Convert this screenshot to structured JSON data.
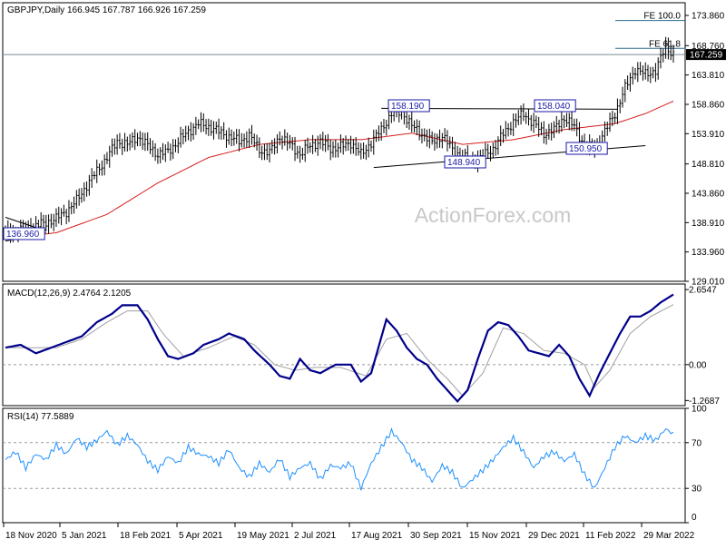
{
  "chart_data": [
    {
      "type": "candlestick",
      "symbol": "GBPJPY",
      "timeframe": "Daily",
      "header": "GBPJPY,Daily  166.945 167.787 166.926 167.259",
      "ohlc_last": [
        166.945,
        167.787,
        166.926,
        167.259
      ],
      "last_price_label": "167.259",
      "watermark": "ActionForex.com",
      "ylim": [
        129.01,
        176.0
      ],
      "y_ticks": [
        "173.860",
        "168.760",
        "163.810",
        "158.860",
        "153.910",
        "148.810",
        "143.860",
        "138.910",
        "133.960",
        "129.010"
      ],
      "x_ticks": [
        "18 Nov 2020",
        "5 Jan 2021",
        "18 Feb 2021",
        "5 Apr 2021",
        "19 May 2021",
        "2 Jul 2021",
        "17 Aug 2021",
        "30 Sep 2021",
        "15 Nov 2021",
        "29 Dec 2021",
        "11 Feb 2022",
        "29 Mar 2022"
      ],
      "price_path": [
        [
          0,
          137.5
        ],
        [
          4,
          137.2
        ],
        [
          8,
          137.9
        ],
        [
          12,
          138.4
        ],
        [
          16,
          138.9
        ],
        [
          20,
          139.6
        ],
        [
          24,
          140.8
        ],
        [
          28,
          142.6
        ],
        [
          32,
          145.2
        ],
        [
          36,
          147.6
        ],
        [
          40,
          149.9
        ],
        [
          44,
          152.6
        ],
        [
          48,
          152.1
        ],
        [
          52,
          153.4
        ],
        [
          56,
          151.9
        ],
        [
          60,
          150.4
        ],
        [
          64,
          150.9
        ],
        [
          68,
          152.6
        ],
        [
          72,
          154.3
        ],
        [
          76,
          155.6
        ],
        [
          80,
          155.1
        ],
        [
          84,
          154.3
        ],
        [
          88,
          153.4
        ],
        [
          92,
          152.6
        ],
        [
          96,
          153.6
        ],
        [
          100,
          151.2
        ],
        [
          104,
          150.7
        ],
        [
          108,
          153.4
        ],
        [
          112,
          152.1
        ],
        [
          116,
          150.4
        ],
        [
          120,
          151.9
        ],
        [
          124,
          152.6
        ],
        [
          128,
          151.4
        ],
        [
          132,
          151.7
        ],
        [
          136,
          152.4
        ],
        [
          140,
          150.4
        ],
        [
          144,
          152.4
        ],
        [
          148,
          154.6
        ],
        [
          152,
          157.3
        ],
        [
          156,
          157.6
        ],
        [
          160,
          155.2
        ],
        [
          164,
          153.9
        ],
        [
          168,
          152.4
        ],
        [
          172,
          153.6
        ],
        [
          176,
          151.2
        ],
        [
          180,
          149.9
        ],
        [
          184,
          149.4
        ],
        [
          188,
          150.1
        ],
        [
          192,
          151.4
        ],
        [
          196,
          153.9
        ],
        [
          200,
          155.9
        ],
        [
          204,
          157.3
        ],
        [
          208,
          155.6
        ],
        [
          212,
          153.9
        ],
        [
          216,
          154.6
        ],
        [
          220,
          156.6
        ],
        [
          224,
          155.1
        ],
        [
          228,
          151.9
        ],
        [
          232,
          151.4
        ],
        [
          236,
          154.3
        ],
        [
          240,
          157.3
        ],
        [
          244,
          161.6
        ],
        [
          248,
          164.8
        ],
        [
          252,
          163.9
        ],
        [
          256,
          164.6
        ],
        [
          260,
          168.6
        ],
        [
          263,
          167.3
        ]
      ],
      "sma_path": [
        [
          0,
          136.2
        ],
        [
          20,
          137.2
        ],
        [
          40,
          140.3
        ],
        [
          60,
          145.6
        ],
        [
          80,
          149.9
        ],
        [
          100,
          152.1
        ],
        [
          120,
          152.9
        ],
        [
          140,
          152.9
        ],
        [
          160,
          154.0
        ],
        [
          180,
          152.1
        ],
        [
          200,
          152.9
        ],
        [
          220,
          154.6
        ],
        [
          240,
          155.6
        ],
        [
          252,
          157.3
        ],
        [
          263,
          159.4
        ]
      ],
      "annotations": [
        {
          "label": "158.190",
          "value": 158.19,
          "target": "price"
        },
        {
          "label": "158.040",
          "value": 158.04,
          "target": "price"
        },
        {
          "label": "148.940",
          "value": 148.94,
          "target": "price"
        },
        {
          "label": "150.950",
          "value": 150.95,
          "target": "price"
        },
        {
          "label": "136.960",
          "value": 136.96,
          "target": "price"
        },
        {
          "label": "FE 100.0",
          "value": 173.0,
          "target": "price"
        },
        {
          "label": "FE 61.8",
          "value": 168.3,
          "target": "price"
        }
      ],
      "trendlines": [
        {
          "from": [
            148,
            158.19
          ],
          "to": [
            241,
            158.04
          ]
        },
        {
          "from": [
            145,
            148.2
          ],
          "to": [
            252,
            151.9
          ]
        }
      ]
    },
    {
      "type": "line",
      "title": "MACD(12,26,9) 2.4764 2.1205",
      "series": [
        {
          "name": "MACD",
          "color": "#00008b",
          "values": [
            [
              0,
              0.6
            ],
            [
              6,
              0.7
            ],
            [
              12,
              0.4
            ],
            [
              18,
              0.6
            ],
            [
              24,
              0.8
            ],
            [
              30,
              1.0
            ],
            [
              36,
              1.5
            ],
            [
              42,
              1.8
            ],
            [
              46,
              2.1
            ],
            [
              52,
              2.1
            ],
            [
              56,
              1.6
            ],
            [
              60,
              0.9
            ],
            [
              64,
              0.3
            ],
            [
              68,
              0.2
            ],
            [
              74,
              0.4
            ],
            [
              78,
              0.7
            ],
            [
              84,
              0.9
            ],
            [
              88,
              1.1
            ],
            [
              94,
              0.9
            ],
            [
              98,
              0.5
            ],
            [
              104,
              0.0
            ],
            [
              108,
              -0.4
            ],
            [
              112,
              -0.5
            ],
            [
              116,
              0.2
            ],
            [
              120,
              -0.2
            ],
            [
              124,
              -0.3
            ],
            [
              130,
              0.0
            ],
            [
              136,
              0.0
            ],
            [
              140,
              -0.6
            ],
            [
              144,
              -0.3
            ],
            [
              150,
              1.6
            ],
            [
              154,
              1.2
            ],
            [
              158,
              0.6
            ],
            [
              162,
              0.2
            ],
            [
              166,
              0.0
            ],
            [
              170,
              -0.5
            ],
            [
              174,
              -0.9
            ],
            [
              178,
              -1.3
            ],
            [
              182,
              -0.9
            ],
            [
              186,
              0.2
            ],
            [
              190,
              1.2
            ],
            [
              194,
              1.5
            ],
            [
              198,
              1.4
            ],
            [
              202,
              1.0
            ],
            [
              206,
              0.5
            ],
            [
              210,
              0.4
            ],
            [
              214,
              0.3
            ],
            [
              218,
              0.7
            ],
            [
              222,
              0.3
            ],
            [
              226,
              -0.5
            ],
            [
              230,
              -1.1
            ],
            [
              234,
              -0.3
            ],
            [
              238,
              0.4
            ],
            [
              242,
              1.1
            ],
            [
              246,
              1.7
            ],
            [
              250,
              1.7
            ],
            [
              254,
              1.9
            ],
            [
              258,
              2.2
            ],
            [
              263,
              2.48
            ]
          ]
        },
        {
          "name": "Signal",
          "color": "#a0a0a0",
          "values": [
            [
              0,
              0.6
            ],
            [
              10,
              0.6
            ],
            [
              20,
              0.6
            ],
            [
              30,
              0.9
            ],
            [
              40,
              1.5
            ],
            [
              48,
              1.9
            ],
            [
              56,
              1.9
            ],
            [
              62,
              1.1
            ],
            [
              70,
              0.3
            ],
            [
              80,
              0.6
            ],
            [
              90,
              1.0
            ],
            [
              98,
              0.7
            ],
            [
              106,
              0.0
            ],
            [
              114,
              -0.2
            ],
            [
              122,
              -0.1
            ],
            [
              132,
              -0.1
            ],
            [
              142,
              -0.4
            ],
            [
              150,
              0.9
            ],
            [
              158,
              1.1
            ],
            [
              166,
              0.2
            ],
            [
              174,
              -0.5
            ],
            [
              180,
              -1.1
            ],
            [
              188,
              -0.3
            ],
            [
              196,
              1.3
            ],
            [
              204,
              1.1
            ],
            [
              212,
              0.5
            ],
            [
              220,
              0.4
            ],
            [
              228,
              0.0
            ],
            [
              232,
              -0.8
            ],
            [
              238,
              -0.2
            ],
            [
              246,
              1.1
            ],
            [
              254,
              1.7
            ],
            [
              263,
              2.12
            ]
          ]
        }
      ],
      "y_ticks": [
        "2.6547",
        "0.00",
        "-1.2687"
      ],
      "ylim": [
        -1.45,
        2.85
      ]
    },
    {
      "type": "line",
      "title": "RSI(14) 77.5889",
      "series": [
        {
          "name": "RSI",
          "color": "#1e90ff",
          "values": [
            [
              0,
              55
            ],
            [
              4,
              62
            ],
            [
              8,
              48
            ],
            [
              12,
              60
            ],
            [
              16,
              55
            ],
            [
              20,
              68
            ],
            [
              24,
              60
            ],
            [
              28,
              74
            ],
            [
              32,
              66
            ],
            [
              36,
              72
            ],
            [
              40,
              80
            ],
            [
              44,
              68
            ],
            [
              48,
              76
            ],
            [
              52,
              68
            ],
            [
              56,
              54
            ],
            [
              60,
              46
            ],
            [
              64,
              58
            ],
            [
              68,
              52
            ],
            [
              72,
              66
            ],
            [
              76,
              60
            ],
            [
              80,
              58
            ],
            [
              84,
              52
            ],
            [
              88,
              64
            ],
            [
              92,
              48
            ],
            [
              96,
              40
            ],
            [
              100,
              52
            ],
            [
              104,
              44
            ],
            [
              108,
              56
            ],
            [
              112,
              40
            ],
            [
              116,
              48
            ],
            [
              120,
              52
            ],
            [
              124,
              38
            ],
            [
              128,
              50
            ],
            [
              132,
              48
            ],
            [
              136,
              52
            ],
            [
              140,
              30
            ],
            [
              144,
              52
            ],
            [
              148,
              66
            ],
            [
              152,
              80
            ],
            [
              156,
              70
            ],
            [
              160,
              55
            ],
            [
              164,
              48
            ],
            [
              168,
              36
            ],
            [
              172,
              50
            ],
            [
              176,
              44
            ],
            [
              180,
              30
            ],
            [
              184,
              38
            ],
            [
              188,
              46
            ],
            [
              192,
              55
            ],
            [
              196,
              66
            ],
            [
              200,
              74
            ],
            [
              204,
              62
            ],
            [
              208,
              48
            ],
            [
              212,
              58
            ],
            [
              216,
              62
            ],
            [
              220,
              54
            ],
            [
              224,
              60
            ],
            [
              228,
              42
            ],
            [
              232,
              30
            ],
            [
              236,
              48
            ],
            [
              240,
              66
            ],
            [
              244,
              76
            ],
            [
              248,
              70
            ],
            [
              252,
              76
            ],
            [
              256,
              72
            ],
            [
              260,
              82
            ],
            [
              263,
              77.6
            ]
          ]
        }
      ],
      "y_ticks": [
        "100",
        "70",
        "30",
        "0"
      ],
      "ylim": [
        0,
        100
      ]
    }
  ]
}
